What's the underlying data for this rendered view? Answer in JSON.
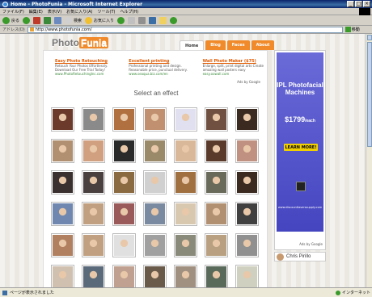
{
  "window": {
    "title": "Home - PhotoFunia - Microsoft Internet Explorer"
  },
  "menu": [
    "ファイル(F)",
    "編集(E)",
    "表示(V)",
    "お気に入り(A)",
    "ツール(T)",
    "ヘルプ(H)"
  ],
  "toolbar": {
    "back": "戻る",
    "search": "検索",
    "favorites": "お気に入り"
  },
  "address": {
    "label": "アドレス(D)",
    "url": "http://www.photofunia.com/",
    "go": "移動"
  },
  "site": {
    "logo_a": "Photo",
    "logo_b": "Funia",
    "tabs": [
      "Home",
      "Blog",
      "Faces",
      "About"
    ]
  },
  "ads": [
    {
      "title": "Easy Photo Retouching",
      "lines": [
        "Retouch Your Photos Effortlessly.",
        "Download Our Free Trial Today!"
      ],
      "url": "www.PhotoRetouchingInc.com"
    },
    {
      "title": "Excellent printing",
      "lines": [
        "Professional printing and design.",
        "Reasonable price, punctual delivery."
      ],
      "url": "www.seaqua.biz.com/en"
    },
    {
      "title": "Wall Photo Maker ($75)",
      "lines": [
        "Enlarge, split, print digital arts Create",
        "amazing wall posters easy"
      ],
      "url": "easy.oowall.com"
    }
  ],
  "ads_by": "Ads by Google",
  "select_title": "Select an effect",
  "thumbs": [
    "#6b3a2a",
    "#8a8a8a",
    "#b07040",
    "#c09070",
    "#e0e0f0",
    "#705040",
    "#3a2a20",
    "#b09070",
    "#d0a080",
    "#2a2a2a",
    "#9a8a6a",
    "#d8b898",
    "#5a3a2a",
    "#c09080",
    "#3a3030",
    "#4a4040",
    "#8a6a40",
    "#d0d0d0",
    "#a07040",
    "#6a6a5a",
    "#3a2a20",
    "#7088b0",
    "#c0a080",
    "#9a5a5a",
    "#7a8aa0",
    "#d8c8b0",
    "#b09070",
    "#404040",
    "#b08060",
    "#c0a080",
    "#e0e0e0",
    "#a0a0a0",
    "#8a8a7a",
    "#b8a080",
    "#909090",
    "#d0c0b0",
    "#5a6a7a",
    "#c0a090",
    "#6a5a4a",
    "#a09080",
    "#5a6a5a",
    "#d0d0c0"
  ],
  "skyscraper": {
    "heading": "IPL Photofacial Machines",
    "price": "$1799",
    "price_unit": "/each",
    "button": "LEARN MORE!",
    "url": "www.discountlaserssupply.com",
    "ads_by": "Ads by Google"
  },
  "user": {
    "name": "Chris Pirillo"
  },
  "status": {
    "text": "ページが表示されました",
    "zone": "インターネット"
  },
  "colors": {
    "accent": "#f08a2a",
    "skyscraper_bg": "#4545c0",
    "titlebar": "#0a246a"
  }
}
